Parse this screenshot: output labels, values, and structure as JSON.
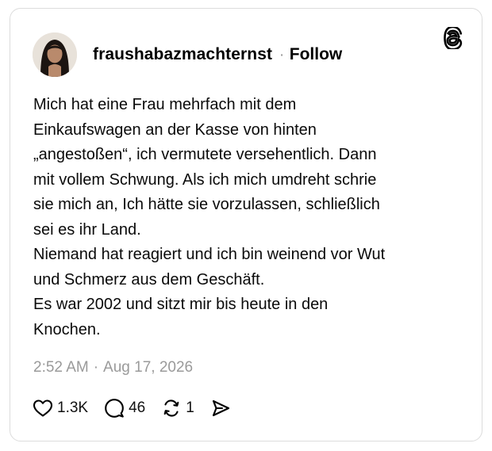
{
  "post": {
    "username": "fraushabazmachternst",
    "separator": "·",
    "follow_label": "Follow",
    "text": "Mich hat eine Frau mehrfach mit dem\nEinkaufswagen an der Kasse von hinten\n„angestoßen“, ich vermutete versehentlich. Dann\nmit vollem Schwung. Als ich mich umdreht schrie\nsie mich an, Ich hätte sie vorzulassen, schließlich\nsei es ihr Land.\nNiemand hat reagiert und ich bin weinend vor Wut\nund Schmerz aus dem Geschäft.\nEs war 2002 und sitzt mir bis heute in den\nKnochen.",
    "time": "2:52 AM",
    "date_separator": "·",
    "date": "Aug 17, 2026"
  },
  "actions": {
    "likes": "1.3K",
    "replies": "46",
    "reposts": "1"
  },
  "icons": {
    "brand": "threads-logo-icon",
    "like": "heart-icon",
    "reply": "speech-bubble-icon",
    "repost": "repost-arrows-icon",
    "share": "send-icon"
  },
  "colors": {
    "text": "#0a0a0a",
    "muted": "#9a9a9a",
    "border": "#dcdcdc"
  }
}
